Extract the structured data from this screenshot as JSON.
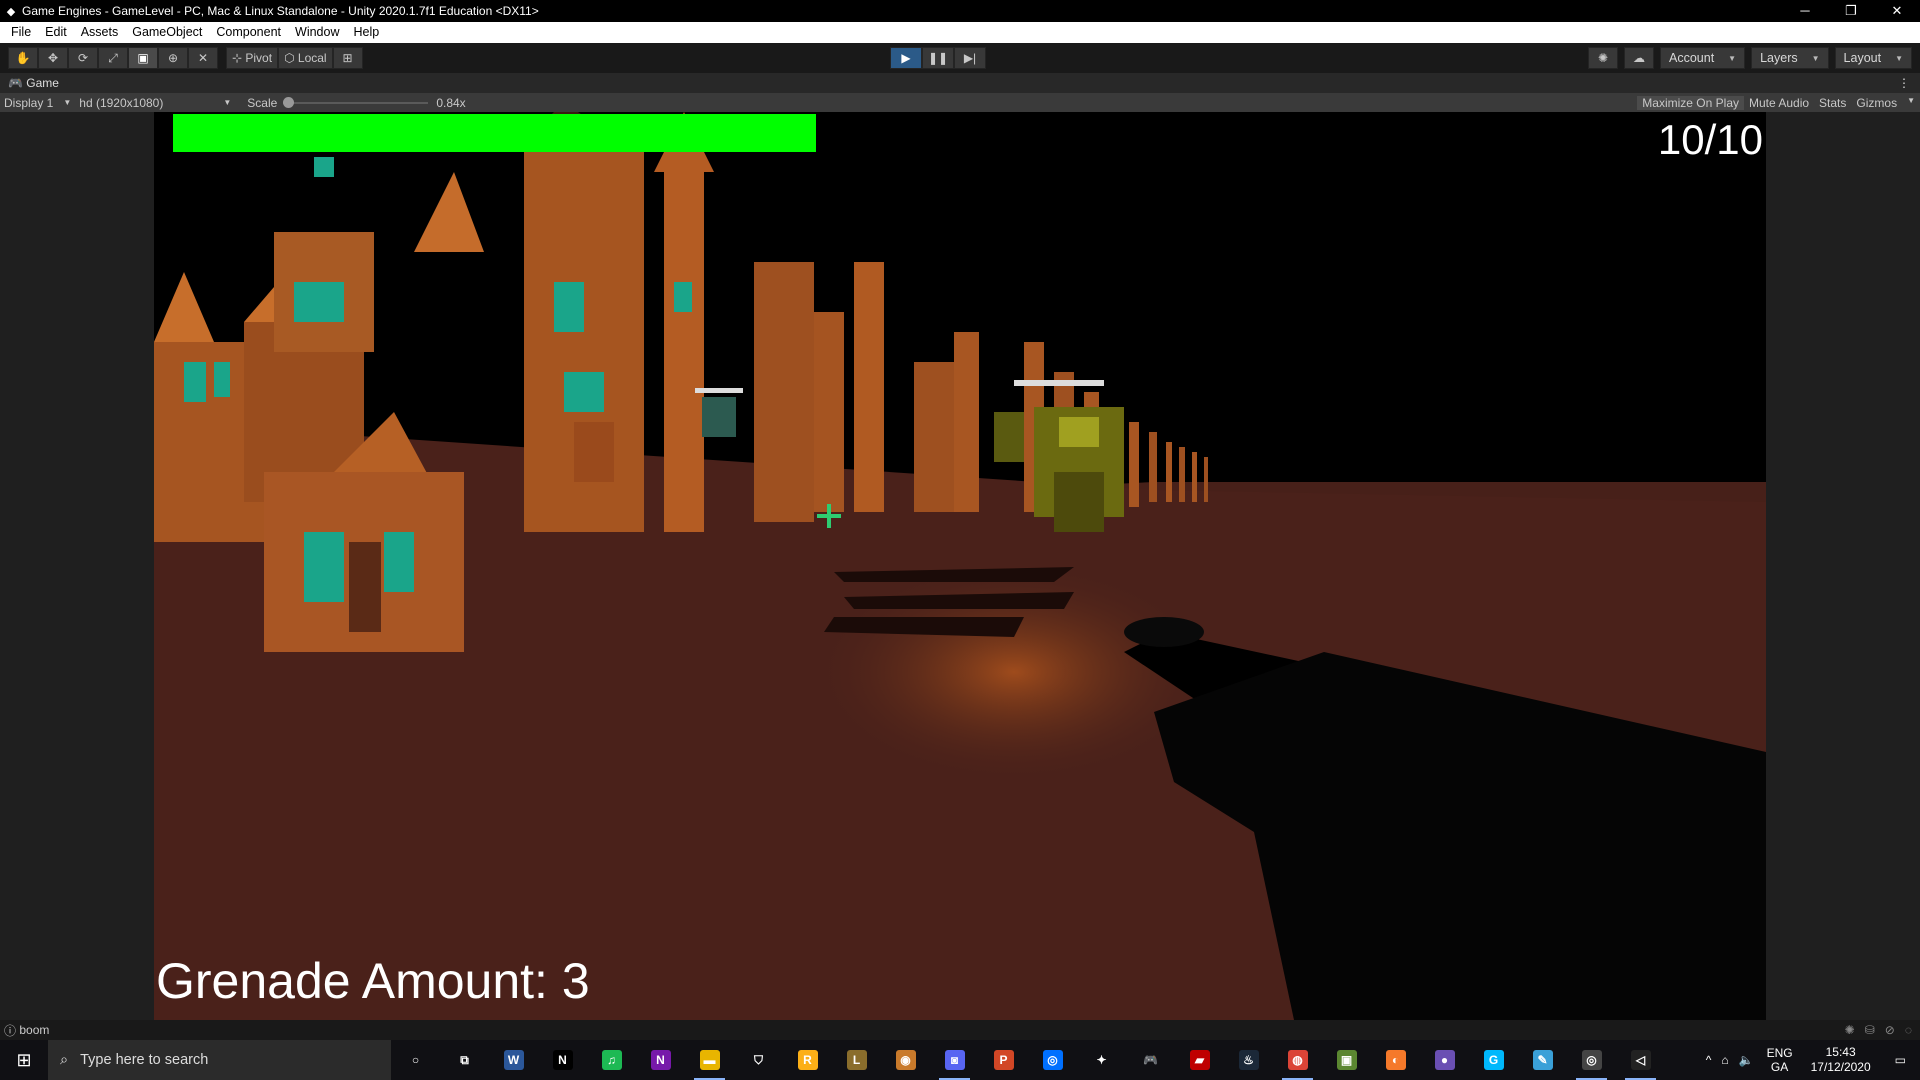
{
  "window": {
    "title": "Game Engines - GameLevel - PC, Mac & Linux Standalone - Unity 2020.1.7f1 Education <DX11>",
    "minimize": "─",
    "restore": "❐",
    "close": "✕"
  },
  "menu": [
    "File",
    "Edit",
    "Assets",
    "GameObject",
    "Component",
    "Window",
    "Help"
  ],
  "toolbar": {
    "pivot_label": "Pivot",
    "local_label": "Local",
    "account_label": "Account",
    "layers_label": "Layers",
    "layout_label": "Layout"
  },
  "game_tab": {
    "label": "Game"
  },
  "game_controls": {
    "display": "Display 1",
    "resolution": "hd (1920x1080)",
    "scale_label": "Scale",
    "scale_value": "0.84x",
    "scale_fraction": 0.0,
    "maximize_on_play": "Maximize On Play",
    "mute_audio": "Mute Audio",
    "stats": "Stats",
    "gizmos": "Gizmos"
  },
  "hud": {
    "health_fraction": 1.0,
    "ammo": "10/10",
    "grenade_label": "Grenade Amount:",
    "grenade_count": "3"
  },
  "status": {
    "message": "boom"
  },
  "taskbar": {
    "search_placeholder": "Type here to search",
    "apps": [
      {
        "name": "cortana",
        "glyph": "○",
        "color": "transparent"
      },
      {
        "name": "task-view",
        "glyph": "⧉",
        "color": "transparent"
      },
      {
        "name": "word",
        "glyph": "W",
        "color": "#2b579a"
      },
      {
        "name": "netflix",
        "glyph": "N",
        "color": "#000000"
      },
      {
        "name": "spotify",
        "glyph": "♫",
        "color": "#1db954"
      },
      {
        "name": "onenote",
        "glyph": "N",
        "color": "#7719aa"
      },
      {
        "name": "file-explorer",
        "glyph": "▬",
        "color": "#e8b500"
      },
      {
        "name": "shield-app",
        "glyph": "⛉",
        "color": "transparent"
      },
      {
        "name": "rockstar",
        "glyph": "R",
        "color": "#fcaf17"
      },
      {
        "name": "league",
        "glyph": "L",
        "color": "#8a6d2c"
      },
      {
        "name": "origin",
        "glyph": "◉",
        "color": "#c97a2b"
      },
      {
        "name": "discord",
        "glyph": "◙",
        "color": "#5865f2"
      },
      {
        "name": "powerpoint",
        "glyph": "P",
        "color": "#d24726"
      },
      {
        "name": "uplay",
        "glyph": "◎",
        "color": "#0070ff"
      },
      {
        "name": "inkscape",
        "glyph": "✦",
        "color": "transparent"
      },
      {
        "name": "controller",
        "glyph": "🎮",
        "color": "transparent"
      },
      {
        "name": "filezilla",
        "glyph": "▰",
        "color": "#bf0000"
      },
      {
        "name": "steam",
        "glyph": "♨",
        "color": "#1b2838"
      },
      {
        "name": "chrome",
        "glyph": "◍",
        "color": "#db4437"
      },
      {
        "name": "minecraft",
        "glyph": "▣",
        "color": "#5b8731"
      },
      {
        "name": "blender",
        "glyph": "◐",
        "color": "#f5792a"
      },
      {
        "name": "obs",
        "glyph": "●",
        "color": "#6a4fb3"
      },
      {
        "name": "logitech",
        "glyph": "G",
        "color": "#00b8fc"
      },
      {
        "name": "notepad",
        "glyph": "✎",
        "color": "#3aa0d8"
      },
      {
        "name": "unity-hub",
        "glyph": "◎",
        "color": "#444444"
      },
      {
        "name": "unity",
        "glyph": "◁",
        "color": "#222222"
      }
    ],
    "lang_top": "ENG",
    "lang_bottom": "GA",
    "time": "15:43",
    "date": "17/12/2020"
  },
  "colors": {
    "health": "#00ff00",
    "play_active": "#2b5a88"
  }
}
